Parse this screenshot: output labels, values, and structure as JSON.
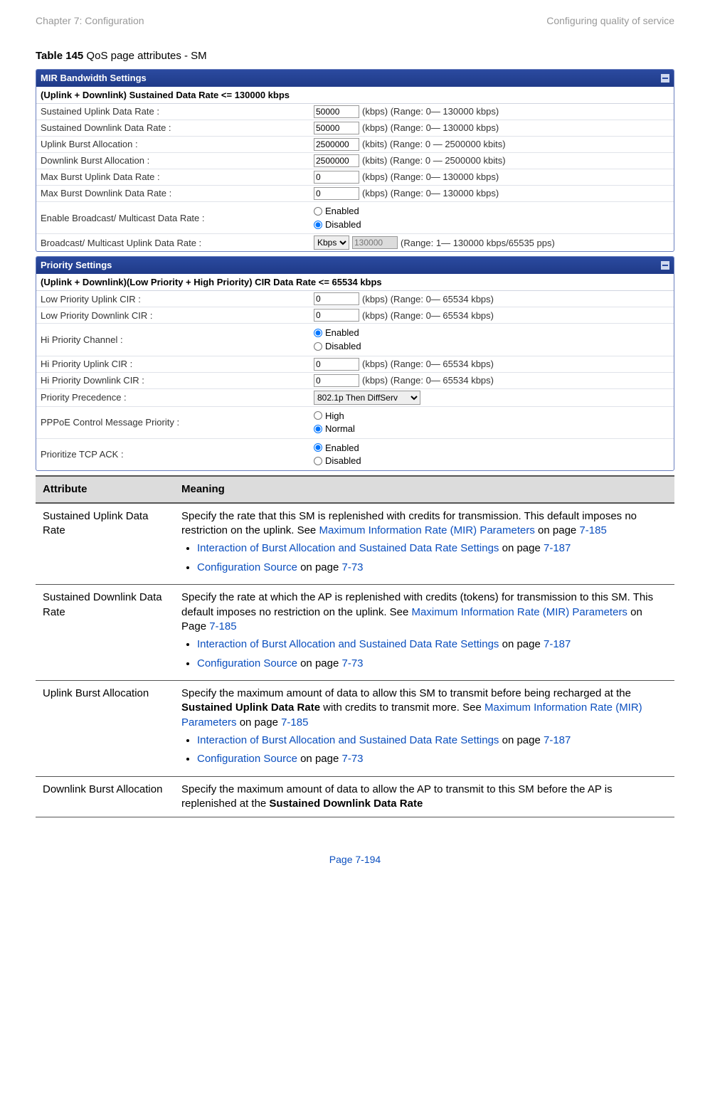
{
  "header": {
    "left": "Chapter 7:  Configuration",
    "right": "Configuring quality of service"
  },
  "caption": {
    "bold": "Table 145",
    "rest": " QoS page attributes - SM"
  },
  "mir": {
    "title": "MIR Bandwidth Settings",
    "subhead": "(Uplink + Downlink) Sustained Data Rate <= 130000 kbps",
    "rows": {
      "sustained_uplink": {
        "label": "Sustained Uplink Data Rate :",
        "value": "50000",
        "hint": "(kbps) (Range: 0— 130000 kbps)"
      },
      "sustained_downlink": {
        "label": "Sustained Downlink Data Rate :",
        "value": "50000",
        "hint": "(kbps) (Range: 0— 130000 kbps)"
      },
      "uplink_burst": {
        "label": "Uplink Burst Allocation :",
        "value": "2500000",
        "hint": "(kbits) (Range: 0 — 2500000 kbits)"
      },
      "downlink_burst": {
        "label": "Downlink Burst Allocation :",
        "value": "2500000",
        "hint": "(kbits) (Range: 0 — 2500000 kbits)"
      },
      "max_burst_uplink": {
        "label": "Max Burst Uplink Data Rate :",
        "value": "0",
        "hint": "(kbps) (Range: 0— 130000 kbps)"
      },
      "max_burst_downlink": {
        "label": "Max Burst Downlink Data Rate :",
        "value": "0",
        "hint": "(kbps) (Range: 0— 130000 kbps)"
      },
      "enable_bcast": {
        "label": "Enable Broadcast/ Multicast Data Rate :",
        "opt1": "Enabled",
        "opt2": "Disabled"
      },
      "bcast_uplink": {
        "label": "Broadcast/ Multicast Uplink Data Rate :",
        "select": "Kbps",
        "value": "130000",
        "hint": "(Range: 1— 130000 kbps/65535 pps)"
      }
    }
  },
  "priority": {
    "title": "Priority Settings",
    "subhead": "(Uplink + Downlink)(Low Priority + High Priority) CIR Data Rate <= 65534 kbps",
    "rows": {
      "low_up": {
        "label": "Low Priority Uplink CIR :",
        "value": "0",
        "hint": "(kbps) (Range: 0— 65534 kbps)"
      },
      "low_down": {
        "label": "Low Priority Downlink CIR :",
        "value": "0",
        "hint": "(kbps) (Range: 0— 65534 kbps)"
      },
      "hi_channel": {
        "label": "Hi Priority Channel :",
        "opt1": "Enabled",
        "opt2": "Disabled"
      },
      "hi_up": {
        "label": "Hi Priority Uplink CIR :",
        "value": "0",
        "hint": "(kbps) (Range: 0— 65534 kbps)"
      },
      "hi_down": {
        "label": "Hi Priority Downlink CIR :",
        "value": "0",
        "hint": "(kbps) (Range: 0— 65534 kbps)"
      },
      "precedence": {
        "label": "Priority Precedence :",
        "select": "802.1p Then DiffServ"
      },
      "pppoe": {
        "label": "PPPoE Control Message Priority :",
        "opt1": "High",
        "opt2": "Normal"
      },
      "tcp_ack": {
        "label": "Prioritize TCP ACK :",
        "opt1": "Enabled",
        "opt2": "Disabled"
      }
    }
  },
  "attr_table": {
    "col1": "Attribute",
    "col2": "Meaning",
    "r1": {
      "attr": "Sustained Uplink Data Rate",
      "t1": "Specify the rate that this SM is replenished with credits for transmission. This default imposes no restriction on the uplink. See ",
      "link1": "Maximum Information Rate (MIR) Parameters",
      "t2": " on page ",
      "p1": "7-185",
      "li1a": "Interaction of Burst Allocation and Sustained Data Rate Settings",
      "li1b": " on page ",
      "li1c": "7-187",
      "li2a": "Configuration Source",
      "li2b": " on page ",
      "li2c": "7-73"
    },
    "r2": {
      "attr": "Sustained Downlink Data Rate",
      "t1": "Specify the rate at which the AP is replenished with credits (tokens) for transmission to this SM. This default imposes no restriction on the uplink. See ",
      "link1": "Maximum Information Rate (MIR) Parameters",
      "t2": " on Page ",
      "p1": "7-185",
      "li1a": "Interaction of Burst Allocation and Sustained Data Rate Settings",
      "li1b": " on page ",
      "li1c": "7-187",
      "li2a": "Configuration Source",
      "li2b": " on page ",
      "li2c": "7-73"
    },
    "r3": {
      "attr": "Uplink Burst Allocation",
      "t1": "Specify the maximum amount of data to allow this SM to transmit before being recharged at the ",
      "bold": "Sustained Uplink Data Rate",
      "t2": " with credits to transmit more. See ",
      "link1": "Maximum Information Rate (MIR) Parameters",
      "t3": " on page ",
      "p1": "7-185",
      "li1a": "Interaction of Burst Allocation and Sustained Data Rate Settings",
      "li1b": " on page ",
      "li1c": "7-187",
      "li2a": "Configuration Source",
      "li2b": " on page ",
      "li2c": "7-73"
    },
    "r4": {
      "attr": "Downlink Burst Allocation",
      "t1": "Specify the maximum amount of data to allow the AP to transmit to this SM before the AP is replenished at the ",
      "bold": "Sustained Downlink Data Rate"
    }
  },
  "footer": "Page 7-194"
}
